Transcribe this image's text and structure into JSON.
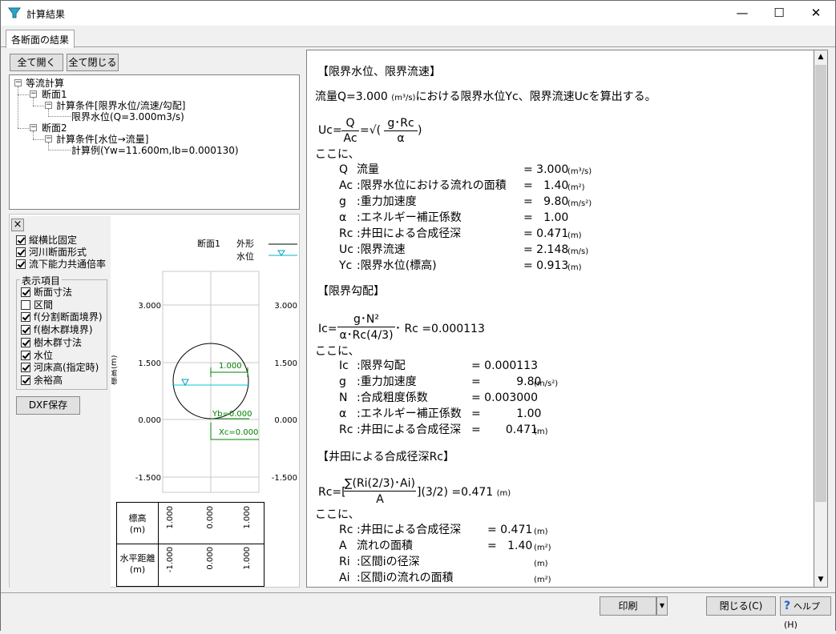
{
  "window": {
    "title": "計算結果",
    "minimize": "—",
    "maximize": "☐",
    "close": "✕"
  },
  "tab": "各断面の結果",
  "tree_buttons": {
    "expand_all": "全て開く",
    "collapse_all": "全て閉じる"
  },
  "tree": {
    "root": "等流計算",
    "s1": "断面1",
    "s1_cond": "計算条件[限界水位/流速/勾配]",
    "s1_item": "限界水位(Q=3.000m3/s)",
    "s2": "断面2",
    "s2_cond": "計算条件[水位→流量]",
    "s2_item": "計算例(Yw=11.600m,Ib=0.000130)"
  },
  "options": {
    "close": "×",
    "fixed_ratio": "縦横比固定",
    "river_section": "河川断面形式",
    "shared_rate": "流下能力共通倍率"
  },
  "display": {
    "title": "表示項目",
    "items": [
      {
        "label": "断面寸法",
        "checked": true
      },
      {
        "label": "区間",
        "checked": false
      },
      {
        "label": "f(分割断面境界)",
        "checked": true
      },
      {
        "label": "f(樹木群境界)",
        "checked": true
      },
      {
        "label": "樹木群寸法",
        "checked": true
      },
      {
        "label": "水位",
        "checked": true
      },
      {
        "label": "河床高(指定時)",
        "checked": true
      },
      {
        "label": "余裕高",
        "checked": true
      }
    ]
  },
  "dxf_button": "DXF保存",
  "drawing": {
    "section_label": "断面1",
    "legend_outline": "外形",
    "legend_water": "水位",
    "y_axis_label": "標高(m)",
    "ticks": [
      "3.000",
      "1.500",
      "0.000",
      "-1.500"
    ],
    "dim_width": "1.000",
    "yb": "Yb=0.000",
    "xc": "Xc=0.000",
    "table_h1": "標高\n(m)",
    "table_h2": "水平距離\n(m)",
    "elev": [
      "1.000",
      "0.000",
      "1.000"
    ],
    "dist": [
      "-1.000",
      "0.000",
      "1.000"
    ]
  },
  "content": {
    "h1": "【限界水位、限界流速】",
    "intro_a": "流量Q=3.000",
    "intro_unit": "(m³/s)",
    "intro_b": "における限界水位Yc、限界流速Ucを算出する。",
    "uc_lhs": "Uc=",
    "uc_num": "Q",
    "uc_den": "Ac",
    "uc_mid": "=√(",
    "uc_num2": "g･Rc",
    "uc_den2": "α",
    "uc_end": ")",
    "where": "ここに、",
    "vars1": [
      {
        "s": "Q",
        "d": "流量",
        "v": "= 3.000",
        "u": "(m³/s)"
      },
      {
        "s": "Ac",
        "d": ":限界水位における流れの面積",
        "v": "=   1.40",
        "u": "(m²)"
      },
      {
        "s": "g",
        "d": ":重力加速度",
        "v": "=   9.80",
        "u": "(m/s²)"
      },
      {
        "s": "α",
        "d": ":エネルギー補正係数",
        "v": "=   1.00",
        "u": ""
      },
      {
        "s": "Rc",
        "d": ":井田による合成径深",
        "v": "= 0.471",
        "u": "(m)"
      },
      {
        "s": "Uc",
        "d": ":限界流速",
        "v": "= 2.148",
        "u": "(m/s)"
      },
      {
        "s": "Yc",
        "d": ":限界水位(標高)",
        "v": "= 0.913",
        "u": "(m)"
      }
    ],
    "h2": "【限界勾配】",
    "ic_lhs": "Ic=",
    "ic_num": "g･N²",
    "ic_den": "α･Rc(4/3)",
    "ic_rhs": "･ Rc =0.000113",
    "vars2": [
      {
        "s": "Ic",
        "d": ":限界勾配",
        "v": "= 0.000113",
        "u": ""
      },
      {
        "s": "g",
        "d": ":重力加速度",
        "v": "=          9.80",
        "u": "(m/s²)"
      },
      {
        "s": "N",
        "d": ":合成粗度係数",
        "v": "= 0.003000",
        "u": ""
      },
      {
        "s": "α",
        "d": ":エネルギー補正係数",
        "v": "=          1.00",
        "u": ""
      },
      {
        "s": "Rc",
        "d": ":井田による合成径深",
        "v": "=       0.471",
        "u": "(m)"
      }
    ],
    "h3": "【井田による合成径深Rc】",
    "rc_lhs": "Rc=[",
    "rc_num": "∑(Ri(2/3)･Ai)",
    "rc_den": "A",
    "rc_rhs": "](3/2) =0.471",
    "rc_unit": "(m)",
    "vars3": [
      {
        "s": "Rc",
        "d": ":井田による合成径深",
        "v": "= 0.471",
        "u": "(m)"
      },
      {
        "s": "A",
        "d": "流れの面積",
        "v": "=   1.40",
        "u": "(m²)"
      },
      {
        "s": "Ri",
        "d": ":区間iの径深",
        "v": "",
        "u": "(m)"
      },
      {
        "s": "Ai",
        "d": ":区間iの流れの面積",
        "v": "",
        "u": "(m²)"
      }
    ]
  },
  "footer": {
    "print": "印刷",
    "close": "閉じる(C)",
    "help": "ヘルプ(H)"
  }
}
